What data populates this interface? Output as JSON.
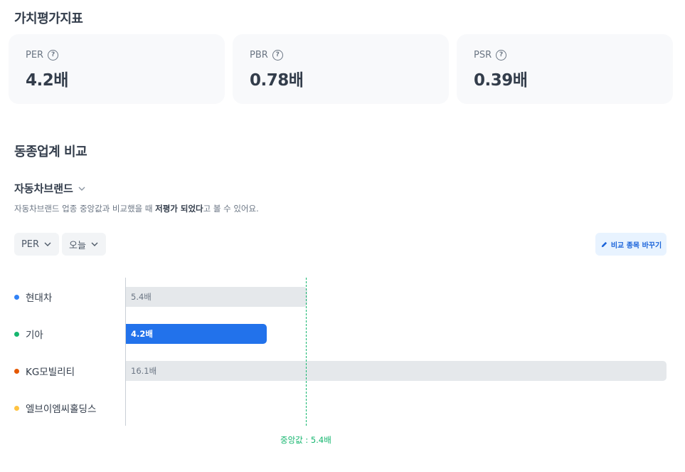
{
  "valuation": {
    "title": "가치평가지표",
    "cards": [
      {
        "label": "PER",
        "value": "4.2배"
      },
      {
        "label": "PBR",
        "value": "0.78배"
      },
      {
        "label": "PSR",
        "value": "0.39배"
      }
    ]
  },
  "peer": {
    "title": "동종업계 비교",
    "industry": "자동차브랜드",
    "description_pre": "자동차브랜드 업종 중앙값과 비교했을 때 ",
    "description_bold": "저평가 되었다",
    "description_post": "고 볼 수 있어요.",
    "filters": {
      "metric": "PER",
      "period": "오늘"
    },
    "change_button": "비교 종목 바꾸기",
    "median_label": "중앙값 : 5.4배",
    "rows": [
      {
        "name": "현대차",
        "value_label": "5.4배",
        "value": 5.4,
        "color": "#3182f6",
        "highlight": false
      },
      {
        "name": "기아",
        "value_label": "4.2배",
        "value": 4.2,
        "color": "#16b66f",
        "highlight": true
      },
      {
        "name": "KG모빌리티",
        "value_label": "16.1배",
        "value": 16.1,
        "color": "#e55800",
        "highlight": false
      },
      {
        "name": "엘브이엠씨홀딩스",
        "value_label": "",
        "value": null,
        "color": "#ffc342",
        "highlight": false
      }
    ]
  }
}
